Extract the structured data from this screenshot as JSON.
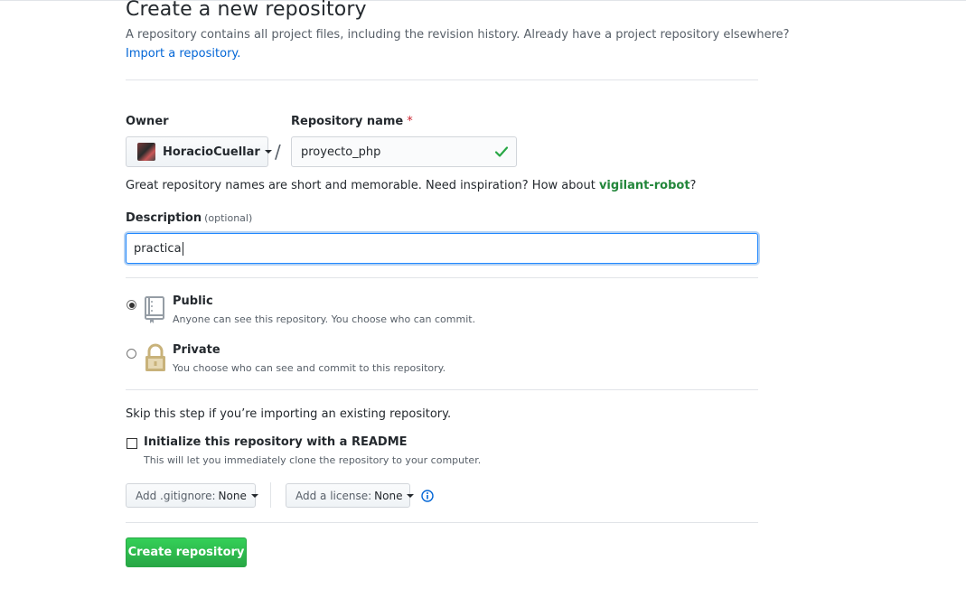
{
  "header": {
    "title": "Create a new repository",
    "subtitle": "A repository contains all project files, including the revision history. Already have a project repository elsewhere?",
    "import_link": "Import a repository."
  },
  "owner": {
    "label": "Owner",
    "value": "HoracioCuellar"
  },
  "repo_name": {
    "label": "Repository name",
    "required_mark": "*",
    "value": "proyecto_php",
    "slash": "/"
  },
  "name_hint": {
    "prefix": "Great repository names are short and memorable. Need inspiration? How about ",
    "suggestion": "vigilant-robot",
    "suffix": "?"
  },
  "description": {
    "label": "Description",
    "optional": "(optional)",
    "value": "practica"
  },
  "visibility": {
    "public": {
      "title": "Public",
      "desc": "Anyone can see this repository. You choose who can commit.",
      "selected": true
    },
    "private": {
      "title": "Private",
      "desc": "You choose who can see and commit to this repository.",
      "selected": false
    }
  },
  "init": {
    "skip_text": "Skip this step if you’re importing an existing repository.",
    "readme_label": "Initialize this repository with a README",
    "readme_desc": "This will let you immediately clone the repository to your computer.",
    "readme_checked": false
  },
  "selects": {
    "gitignore_prefix": "Add .gitignore:",
    "gitignore_value": "None",
    "license_prefix": "Add a license:",
    "license_value": "None"
  },
  "submit": {
    "label": "Create repository"
  },
  "colors": {
    "link": "#0366d6",
    "suggestion": "#22863a",
    "primary_button": "#28a745",
    "focus_border": "#2188ff"
  }
}
